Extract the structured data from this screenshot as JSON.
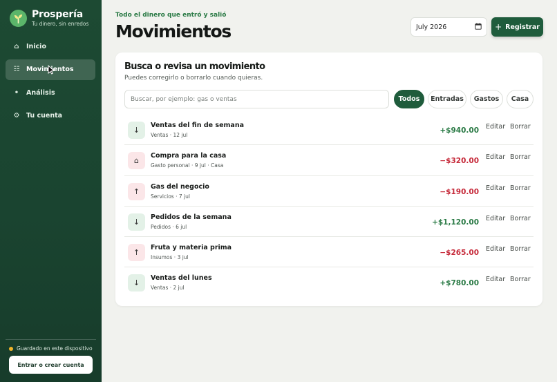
{
  "brand": {
    "name": "Prospería",
    "tagline": "Tu dinero, sin enredos",
    "logo_icon": "sprout-icon"
  },
  "nav": [
    {
      "label": "Inicio",
      "icon": "home-icon",
      "glyph": "⌂",
      "active": false
    },
    {
      "label": "Movimientos",
      "icon": "list-icon",
      "glyph": "☷",
      "active": true
    },
    {
      "label": "Análisis",
      "icon": "dot-icon",
      "glyph": "•",
      "active": false
    },
    {
      "label": "Tu cuenta",
      "icon": "gear-icon",
      "glyph": "⚙",
      "active": false
    }
  ],
  "sidebar_footer": {
    "saved_text": "Guardado en este dispositivo",
    "login_label": "Entrar o crear cuenta"
  },
  "header": {
    "eyebrow": "Todo el dinero que entró y salió",
    "title": "Movimientos",
    "month_value": "July 2026",
    "register_label": "Registrar"
  },
  "card": {
    "title": "Busca o revisa un movimiento",
    "subtitle": "Puedes corregirlo o borrarlo cuando quieras.",
    "search_placeholder": "Buscar, por ejemplo: gas o ventas",
    "filters": [
      "Todos",
      "Entradas",
      "Gastos",
      "Casa"
    ],
    "active_filter": "Todos"
  },
  "transactions": [
    {
      "title": "Ventas del fin de semana",
      "meta": "Ventas · 12 jul",
      "amount": "+$940.00",
      "type": "in",
      "glyph": "↓"
    },
    {
      "title": "Compra para la casa",
      "meta": "Gasto personal · 9 jul · Casa",
      "amount": "−$320.00",
      "type": "out",
      "glyph": "⌂"
    },
    {
      "title": "Gas del negocio",
      "meta": "Servicios · 7 jul",
      "amount": "−$190.00",
      "type": "out",
      "glyph": "↑"
    },
    {
      "title": "Pedidos de la semana",
      "meta": "Pedidos · 6 jul",
      "amount": "+$1,120.00",
      "type": "in",
      "glyph": "↓"
    },
    {
      "title": "Fruta y materia prima",
      "meta": "Insumos · 3 jul",
      "amount": "−$265.00",
      "type": "out",
      "glyph": "↑"
    },
    {
      "title": "Ventas del lunes",
      "meta": "Ventas · 2 jul",
      "amount": "+$780.00",
      "type": "in",
      "glyph": "↓"
    }
  ],
  "row_actions": {
    "edit": "Editar",
    "delete": "Borrar"
  },
  "colors": {
    "sidebar": "#1d4a33",
    "accent": "#1f5c3c",
    "positive": "#2a7a45",
    "negative": "#c62a3a"
  }
}
